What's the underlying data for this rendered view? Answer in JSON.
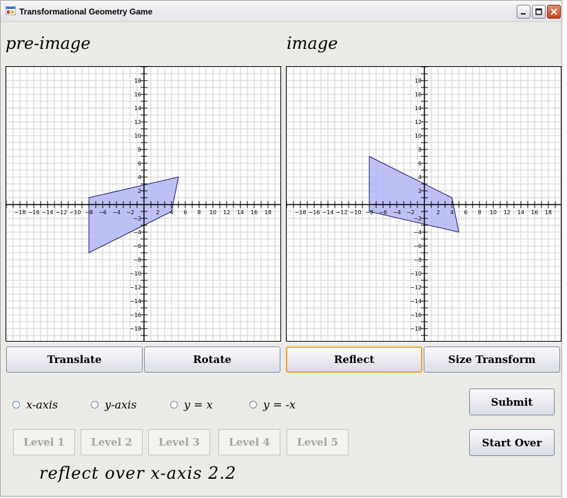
{
  "window": {
    "title": "Transformational Geometry Game"
  },
  "headings": {
    "preimage": "pre-image",
    "image": "image"
  },
  "graph": {
    "ticks": [
      -18,
      -16,
      -14,
      -12,
      -10,
      -8,
      -6,
      -4,
      -2,
      2,
      4,
      6,
      8,
      10,
      12,
      14,
      16,
      18
    ],
    "preimage": {
      "points": [
        [
          -8,
          1
        ],
        [
          5,
          4
        ],
        [
          4,
          -1
        ],
        [
          -8,
          -7
        ]
      ],
      "fill": "#b3b6f3"
    },
    "image": {
      "points": [
        [
          -8,
          7
        ],
        [
          4,
          1
        ],
        [
          5,
          -4
        ],
        [
          -8,
          -1
        ]
      ],
      "fill": "#b3b6f3"
    }
  },
  "buttons": {
    "translate": "Translate",
    "rotate": "Rotate",
    "reflect": "Reflect",
    "size_transform": "Size Transform",
    "submit": "Submit",
    "start_over": "Start Over"
  },
  "radios": [
    "x-axis",
    "y-axis",
    "y = x",
    "y = -x"
  ],
  "levels": [
    "Level 1",
    "Level 2",
    "Level 3",
    "Level 4",
    "Level 5"
  ],
  "status": "reflect over x-axis 2.2"
}
